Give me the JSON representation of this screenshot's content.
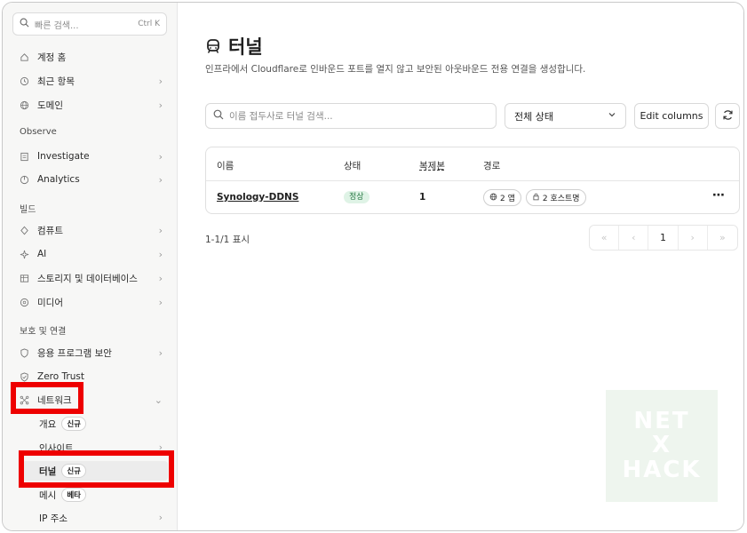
{
  "sidebar": {
    "search": {
      "placeholder": "빠른 검색...",
      "shortcut": "Ctrl K"
    },
    "top_items": [
      {
        "label": "계정 홈",
        "icon": "home-icon"
      },
      {
        "label": "최근 항목",
        "icon": "history-icon"
      },
      {
        "label": "도메인",
        "icon": "globe-icon"
      }
    ],
    "sections": {
      "observe": "Observe",
      "build": "빌드",
      "protect": "보호 및 연결"
    },
    "observe_items": [
      {
        "label": "Investigate",
        "icon": "document-icon"
      },
      {
        "label": "Analytics",
        "icon": "analytics-icon"
      }
    ],
    "build_items": [
      {
        "label": "컴퓨트",
        "icon": "compute-icon"
      },
      {
        "label": "AI",
        "icon": "ai-icon"
      },
      {
        "label": "스토리지 및 데이터베이스",
        "icon": "storage-icon"
      },
      {
        "label": "미디어",
        "icon": "media-icon"
      }
    ],
    "protect_items": [
      {
        "label": "응용 프로그램 보안",
        "icon": "shield-icon"
      },
      {
        "label": "Zero Trust",
        "icon": "shield-check-icon"
      },
      {
        "label": "네트워크",
        "icon": "network-icon"
      }
    ],
    "network_sub": [
      {
        "label": "개요",
        "badge": "신규"
      },
      {
        "label": "인사이트",
        "badge": ""
      },
      {
        "label": "터널",
        "badge": "신규"
      },
      {
        "label": "메시",
        "badge": "베타"
      },
      {
        "label": "IP 주소",
        "badge": ""
      }
    ]
  },
  "main": {
    "title": "터널",
    "subtitle": "인프라에서 Cloudflare로 인바운드 포트를 열지 않고 보안된 아웃바운드 전용 연결을 생성합니다.",
    "search_placeholder": "이름 접두사로 터널 검색...",
    "status_filter": "전체 상태",
    "edit_columns": "Edit columns",
    "table": {
      "headers": [
        "이름",
        "상태",
        "복제본",
        "경로"
      ],
      "rows": [
        {
          "name": "Synology-DDNS",
          "status": "정상",
          "replicas": "1",
          "routes_apps": "2 앱",
          "routes_hosts": "2 호스트명"
        }
      ]
    },
    "count_text": "1-1/1 표시",
    "pagination": {
      "current": "1"
    },
    "watermark": [
      "NET",
      "X",
      "HACK"
    ]
  }
}
